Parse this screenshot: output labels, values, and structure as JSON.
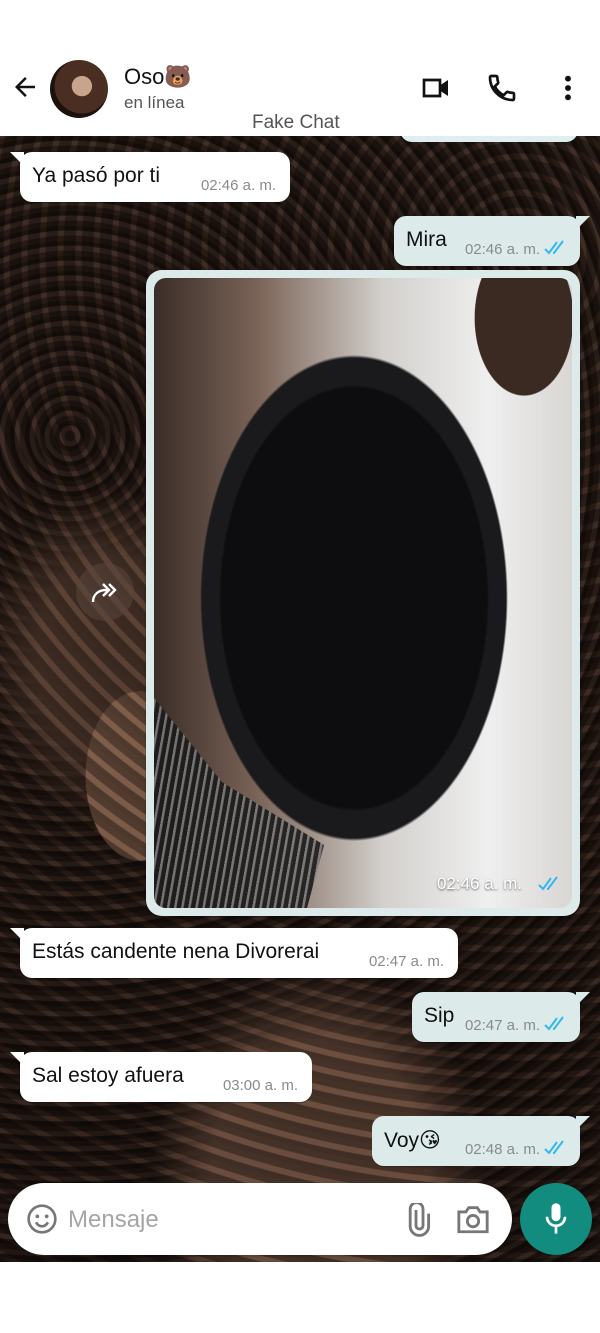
{
  "header": {
    "contact_name": "Oso🐻",
    "status": "en línea",
    "watermark": "Fake Chat"
  },
  "messages": [
    {
      "direction": "incoming",
      "text": "Ya pasó por ti",
      "time": "02:46 a. m."
    },
    {
      "direction": "outgoing",
      "text": "Mira",
      "time": "02:46 a. m.",
      "read": true
    },
    {
      "direction": "outgoing",
      "type": "image",
      "time": "02:46 a. m.",
      "read": true
    },
    {
      "direction": "incoming",
      "text": "Estás candente nena Divorerai",
      "time": "02:47 a. m."
    },
    {
      "direction": "outgoing",
      "text": "Sip",
      "time": "02:47 a. m.",
      "read": true
    },
    {
      "direction": "incoming",
      "text": "Sal estoy afuera",
      "time": "03:00 a. m."
    },
    {
      "direction": "outgoing",
      "text": "Voy😘",
      "time": "02:48 a. m.",
      "read": true
    }
  ],
  "composer": {
    "placeholder": "Mensaje"
  },
  "icons": {
    "back": "arrow-left-icon",
    "video": "video-call-icon",
    "phone": "phone-icon",
    "menu": "more-vert-icon",
    "forward": "forward-icon",
    "emoji": "emoji-icon",
    "attach": "paperclip-icon",
    "camera": "camera-icon",
    "mic": "microphone-icon"
  },
  "colors": {
    "accent": "#128c7e",
    "outgoing_bubble": "#dcebea",
    "incoming_bubble": "#ffffff",
    "read_tick": "#34b7f1"
  }
}
